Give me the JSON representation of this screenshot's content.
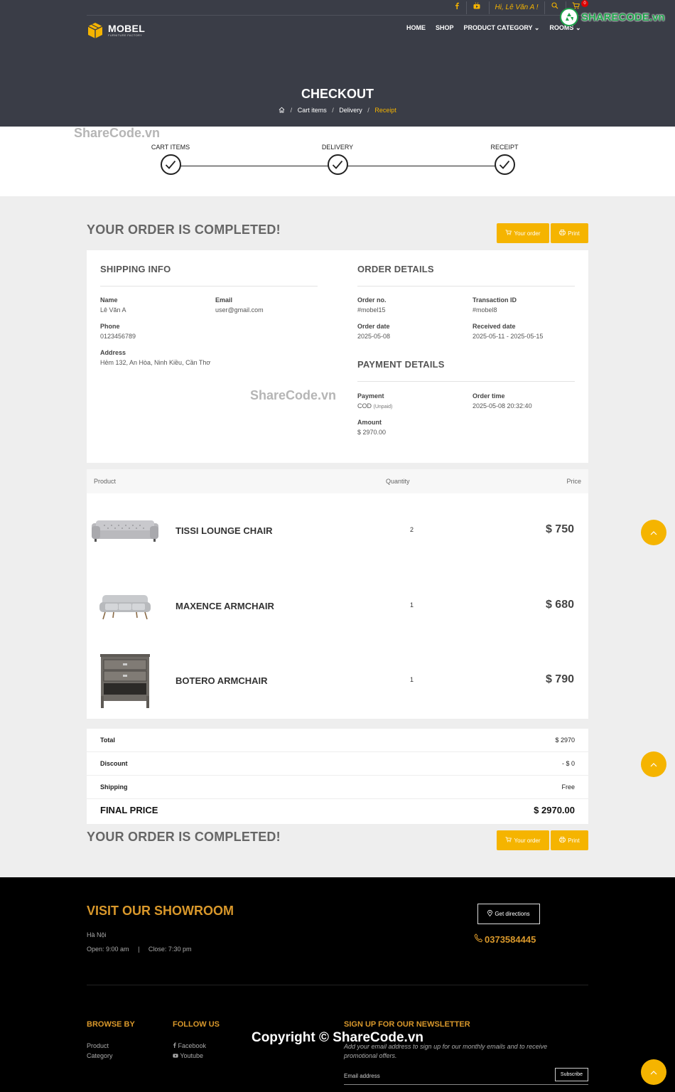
{
  "header": {
    "greeting": "Hi, Lê Văn A !",
    "cart_count": "0",
    "logo_name": "MOBEL",
    "logo_tagline": "FURNITURE FACTORY",
    "nav": [
      "HOME",
      "SHOP",
      "PRODUCT CATEGORY",
      "ROOMS"
    ],
    "page_title": "CHECKOUT",
    "breadcrumb": [
      "Cart items",
      "Delivery",
      "Receipt"
    ]
  },
  "steps": [
    "CART ITEMS",
    "DELIVERY",
    "RECEIPT"
  ],
  "order": {
    "completed_title": "YOUR ORDER IS COMPLETED!",
    "your_order_label": "Your order",
    "print_label": "Print"
  },
  "shipping": {
    "title": "SHIPPING INFO",
    "name_label": "Name",
    "name": "Lê Văn A",
    "email_label": "Email",
    "email": "user@gmail.com",
    "phone_label": "Phone",
    "phone": "0123456789",
    "address_label": "Address",
    "address": "Hẻm 132, An Hòa, Ninh Kiều, Cần Thơ"
  },
  "order_details": {
    "title": "ORDER DETAILS",
    "order_no_label": "Order no.",
    "order_no": "#mobel15",
    "transaction_label": "Transaction ID",
    "transaction": "#mobel8",
    "order_date_label": "Order date",
    "order_date": "2025-05-08",
    "received_label": "Received date",
    "received": "2025-05-11 - 2025-05-15"
  },
  "payment": {
    "title": "PAYMENT DETAILS",
    "payment_label": "Payment",
    "method": "COD",
    "status": "(Unpaid)",
    "time_label": "Order time",
    "time": "2025-05-08 20:32:40",
    "amount_label": "Amount",
    "amount": "$ 2970.00"
  },
  "products": {
    "headers": [
      "Product",
      "Quantity",
      "Price"
    ],
    "rows": [
      {
        "name": "TISSI LOUNGE CHAIR",
        "qty": "2",
        "price": "$ 750"
      },
      {
        "name": "MAXENCE ARMCHAIR",
        "qty": "1",
        "price": "$ 680"
      },
      {
        "name": "BOTERO ARMCHAIR",
        "qty": "1",
        "price": "$ 790"
      }
    ]
  },
  "totals": {
    "total_label": "Total",
    "total": "$ 2970",
    "discount_label": "Discount",
    "discount": "- $ 0",
    "shipping_label": "Shipping",
    "shipping": "Free",
    "final_label": "FINAL PRICE",
    "final": "$ 2970.00"
  },
  "footer": {
    "showroom_title": "VISIT OUR SHOWROOM",
    "city": "Hà Nội",
    "open": "Open: 9:00 am",
    "hours_sep": "|",
    "close": "Close: 7:30 pm",
    "directions": "Get directions",
    "phone": "0373584445",
    "browse_title": "BROWSE BY",
    "browse_links": [
      "Product",
      "Category"
    ],
    "follow_title": "FOLLOW US",
    "follow_links": [
      "Facebook",
      "Youtube"
    ],
    "newsletter_title": "SIGN UP FOR OUR NEWSLETTER",
    "newsletter_text": "Add your email address to sign up for our monthly emails and to receive promotional offers.",
    "email_placeholder": "Email address",
    "subscribe": "Subscribe"
  },
  "watermarks": {
    "brand": "SHARECODE.vn",
    "text": "ShareCode.vn",
    "copyright": "Copyright © ShareCode.vn"
  },
  "colors": {
    "accent": "#f5b400",
    "header_bg": "#3a3d47",
    "footer_accent": "#d9982b"
  }
}
